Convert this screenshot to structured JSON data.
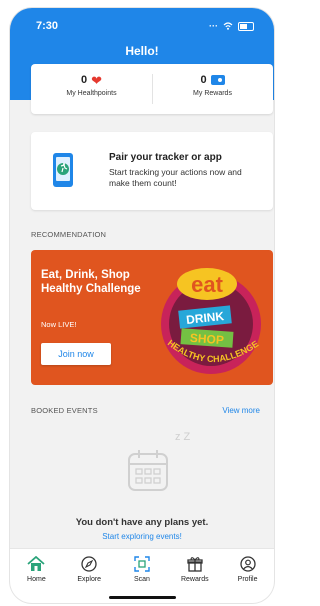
{
  "status_bar": {
    "time": "7:30",
    "signal": "···"
  },
  "header": {
    "greeting": "Hello!"
  },
  "points": {
    "healthpoints": {
      "value": "0",
      "label": "My Healthpoints"
    },
    "rewards": {
      "value": "0",
      "label": "My Rewards"
    }
  },
  "pair_card": {
    "title": "Pair your tracker or app",
    "subtitle": "Start tracking your actions now and make them count!"
  },
  "recommendation": {
    "section_label": "RECOMMENDATION",
    "title": "Eat, Drink, Shop Healthy Challenge",
    "subtitle": "Now LIVE!",
    "button": "Join now",
    "art_text": {
      "eat": "eat",
      "drink": "DRINK",
      "shop": "SHOP",
      "banner": "HEALTHY CHALLENGE"
    }
  },
  "booked_events": {
    "section_label": "BOOKED EVENTS",
    "view_more": "View more",
    "empty_title": "You don't have any plans yet.",
    "empty_link": "Start exploring events!",
    "empty_icon_text": "z Z"
  },
  "tabs": [
    {
      "label": "Home",
      "icon": "home-icon",
      "active": true
    },
    {
      "label": "Explore",
      "icon": "compass-icon",
      "active": false
    },
    {
      "label": "Scan",
      "icon": "scan-icon",
      "active": false
    },
    {
      "label": "Rewards",
      "icon": "gift-icon",
      "active": false
    },
    {
      "label": "Profile",
      "icon": "profile-icon",
      "active": false
    }
  ],
  "colors": {
    "primary": "#1f86e8",
    "banner": "#e0551f",
    "heart": "#e5392f",
    "active_tab": "#2aa37a"
  }
}
